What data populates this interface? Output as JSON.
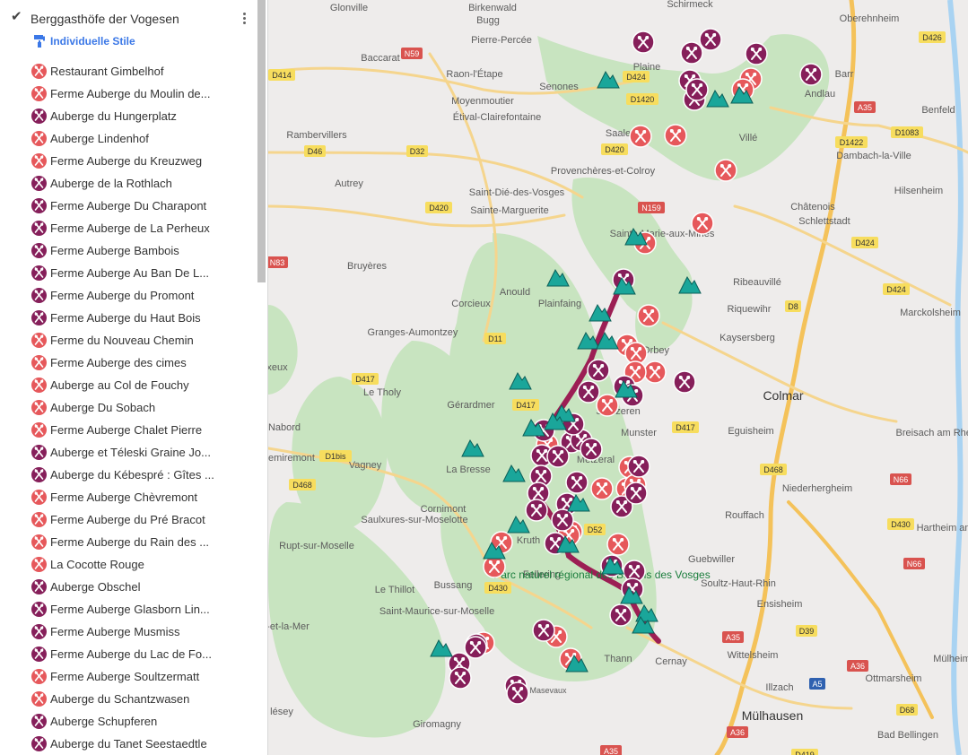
{
  "layer": {
    "title": "Berggasthöfe der Vogesen",
    "style_label": "Individuelle Stile",
    "items": [
      {
        "label": "Restaurant Gimbelhof",
        "color": "light"
      },
      {
        "label": "Ferme Auberge du Moulin de...",
        "color": "light"
      },
      {
        "label": "Auberge du Hungerplatz",
        "color": "dark"
      },
      {
        "label": "Auberge Lindenhof",
        "color": "light"
      },
      {
        "label": "Ferme Auberge du Kreuzweg",
        "color": "light"
      },
      {
        "label": "Auberge de la Rothlach",
        "color": "dark"
      },
      {
        "label": "Ferme Auberge Du Charapont",
        "color": "dark"
      },
      {
        "label": "Ferme Auberge de La Perheux",
        "color": "dark"
      },
      {
        "label": "Ferme Auberge Bambois",
        "color": "dark"
      },
      {
        "label": "Ferme Auberge Au Ban De L...",
        "color": "dark"
      },
      {
        "label": "Ferme Auberge du Promont",
        "color": "dark"
      },
      {
        "label": "Ferme Auberge du Haut Bois",
        "color": "dark"
      },
      {
        "label": "Ferme du Nouveau Chemin",
        "color": "light"
      },
      {
        "label": "Ferme Auberge des cimes",
        "color": "light"
      },
      {
        "label": "Auberge au Col de Fouchy",
        "color": "light"
      },
      {
        "label": "Auberge Du Sobach",
        "color": "light"
      },
      {
        "label": "Ferme Auberge Chalet Pierre",
        "color": "light"
      },
      {
        "label": "Auberge et Téleski Graine Jo...",
        "color": "dark"
      },
      {
        "label": "Auberge du Kébespré : Gîtes ...",
        "color": "dark"
      },
      {
        "label": "Ferme Auberge Chèvremont",
        "color": "light"
      },
      {
        "label": "Ferme Auberge du Pré Bracot",
        "color": "light"
      },
      {
        "label": "Ferme Auberge du Rain des ...",
        "color": "light"
      },
      {
        "label": "La Cocotte Rouge",
        "color": "light"
      },
      {
        "label": "Auberge Obschel",
        "color": "dark"
      },
      {
        "label": "Ferme Auberge Glasborn Lin...",
        "color": "dark"
      },
      {
        "label": "Ferme Auberge Musmiss",
        "color": "dark"
      },
      {
        "label": "Ferme Auberge du Lac de Fo...",
        "color": "dark"
      },
      {
        "label": "Ferme Auberge Soultzermatt",
        "color": "light"
      },
      {
        "label": "Auberge du Schantzwasen",
        "color": "light"
      },
      {
        "label": "Auberge Schupferen",
        "color": "dark"
      },
      {
        "label": "Auberge du Tanet Seestaedtle",
        "color": "dark"
      }
    ]
  },
  "colors": {
    "light_pin": "#e6585b",
    "dark_pin": "#861f5a",
    "peak": "#1aa69a",
    "route": "#9c1e54",
    "accent": "#3b78e7"
  },
  "map": {
    "towns": [
      "Glonville",
      "Birkenwald",
      "Bugg",
      "Schirmeck",
      "Pierre-Percée",
      "Baccarat",
      "Raon-l'Étape",
      "Oberehnheim",
      "Plaine",
      "Barr",
      "Moyenmoutier",
      "Senones",
      "Andlau",
      "Étival-Clairefontaine",
      "Benfeld",
      "Rambervillers",
      "Saale",
      "Villé",
      "Dambach-la-Ville",
      "Provenchères-et-Colroy",
      "Autrey",
      "Hilsenheim",
      "Saint-Dié-des-Vosges",
      "Châtenois",
      "Sainte-Marguerite",
      "Schlettstadt",
      "Sainte-Marie-aux-Mines",
      "Bruyères",
      "Ribeauvillé",
      "Anould",
      "Plainfaing",
      "Corcieux",
      "Riquewihr",
      "Marckolsheim",
      "Granges-Aumontzey",
      "Kaysersberg",
      "Orbey",
      "Le Tholy",
      "Colmar",
      "Gérardmer",
      "Soulzeren",
      "Nabord",
      "Munster",
      "Eguisheim",
      "Breisach am Rhein",
      "La Bresse",
      "Metzeral",
      "Remiremont",
      "Vagney",
      "Niederhergheim",
      "Cornimont",
      "Saulxures-sur-Moselotte",
      "Rouffach",
      "Kruth",
      "Guebwiller",
      "Rupt-sur-Moselle",
      "Fellering",
      "Parc naturel régional des Ballons des Vosges",
      "Le Thillot",
      "Bussang",
      "Soultz-Haut-Rhin",
      "Ensisheim",
      "Saint-Maurice-sur-Moselle",
      "Thann",
      "Cernay",
      "Wittelsheim",
      "Illzach",
      "Ottmarsheim",
      "Masevaux",
      "Mülhausen",
      "Giromagny",
      "Bad Bellingen",
      "Mülheim",
      "Hartheim am Rhein",
      "lésey",
      "-et-la-Mer",
      "xeux"
    ],
    "roads": [
      "D426",
      "N59",
      "D414",
      "D424",
      "D1420",
      "A35",
      "D1083",
      "D32",
      "D420",
      "D46",
      "D1422",
      "D420",
      "N159",
      "D424",
      "D424",
      "N83",
      "D8",
      "D11",
      "D417",
      "D417",
      "D417",
      "D1bis",
      "D468",
      "N66",
      "D468",
      "D430",
      "D52",
      "N66",
      "D430",
      "A35",
      "D39",
      "A36",
      "A5",
      "D68",
      "A36",
      "A35",
      "D419"
    ]
  }
}
